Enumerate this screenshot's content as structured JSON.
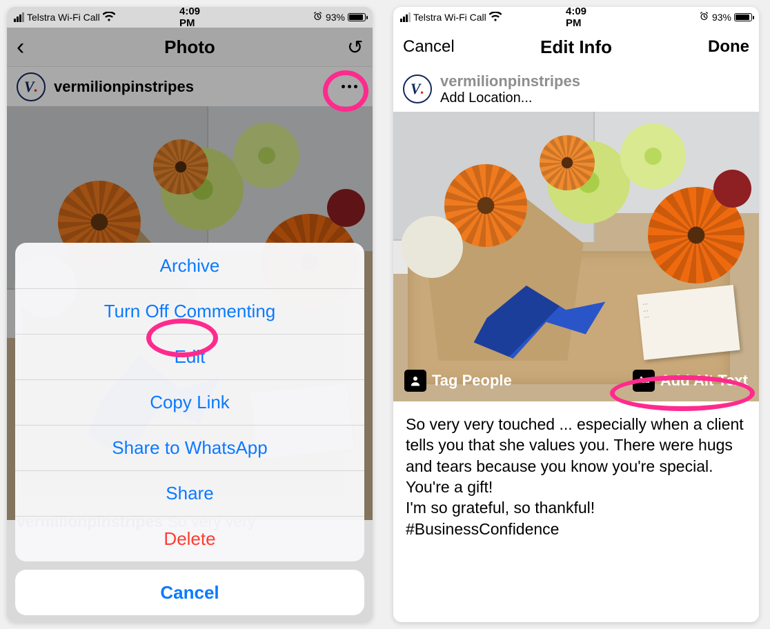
{
  "status": {
    "carrier": "Telstra Wi-Fi Call",
    "time": "4:09 PM",
    "battery_pct": "93%",
    "battery_fill": 93
  },
  "left": {
    "nav_title": "Photo",
    "username": "vermilionpinstripes",
    "caption_user": "vermilionpinstripes",
    "caption_preview": "So very very",
    "sheet": {
      "archive": "Archive",
      "turn_off_commenting": "Turn Off Commenting",
      "edit": "Edit",
      "copy_link": "Copy Link",
      "share_whatsapp": "Share to WhatsApp",
      "share": "Share",
      "delete": "Delete",
      "cancel": "Cancel"
    }
  },
  "right": {
    "cancel": "Cancel",
    "title": "Edit Info",
    "done": "Done",
    "username": "vermilionpinstripes",
    "add_location": "Add Location...",
    "tag_people": "Tag People",
    "add_alt_text": "Add Alt Text",
    "caption": "So very very touched ... especially when a client tells you that she values you. There were hugs and tears because you know you're special. You're a gift!\nI'm so grateful, so thankful! #BusinessConfidence"
  },
  "icons": {
    "person": "person-icon",
    "aa": "Aa"
  }
}
